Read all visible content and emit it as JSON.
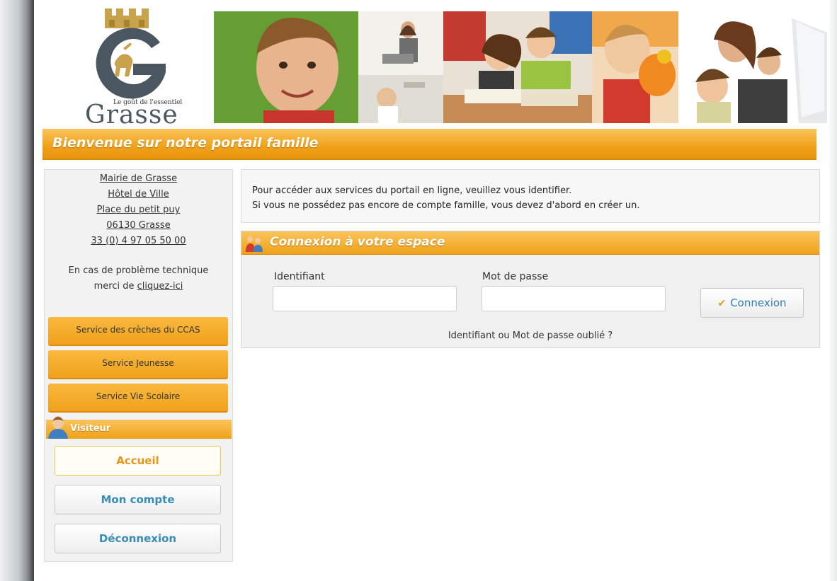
{
  "header": {
    "logo": {
      "word": "Grasse",
      "tagline": "Le goût de l'essentiel"
    },
    "welcome_title": "Bienvenue sur notre portail famille"
  },
  "sidebar": {
    "address": [
      "Mairie de Grasse",
      "Hôtel de Ville",
      "Place du petit puy",
      "06130 Grasse",
      "33 (0) 4 97 05 50 00"
    ],
    "tech_text_1": "En cas de problème technique",
    "tech_text_2": "merci de ",
    "tech_link": "cliquez-ici",
    "services": [
      "Service des crèches du CCAS",
      "Service Jeunesse",
      "Service Vie Scolaire"
    ],
    "visitor_label": "Visiteur",
    "nav": [
      {
        "label": "Accueil",
        "active": true
      },
      {
        "label": "Mon compte",
        "active": false
      },
      {
        "label": "Déconnexion",
        "active": false
      }
    ]
  },
  "main": {
    "info_line_1": "Pour accéder aux services du portail en ligne, veuillez vous identifier.",
    "info_line_2": "Si vous ne possédez pas encore de compte famille, vous devez d'abord en créer un.",
    "login": {
      "title": "Connexion à votre espace",
      "username_label": "Identifiant",
      "username_value": "",
      "password_label": "Mot de passe",
      "password_value": "",
      "submit_label": "Connexion",
      "forgot_label": "Identifiant ou Mot de passe oublié ?"
    }
  },
  "colors": {
    "accent_orange": "#f0a11a",
    "link_blue": "#3a8cb8",
    "active_orange": "#e7961a"
  },
  "icons": [
    "crown-icon",
    "grasse-g-logo-icon",
    "user-icon",
    "family-icon",
    "checkmark-icon"
  ]
}
